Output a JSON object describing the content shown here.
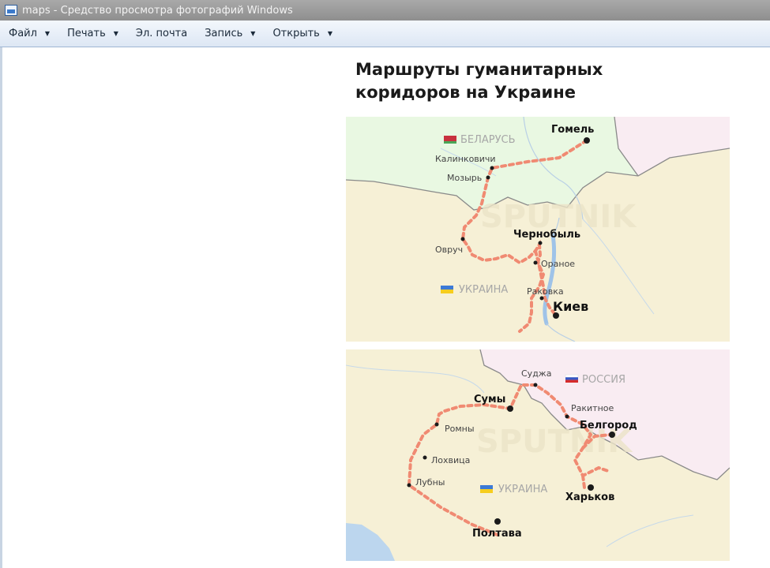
{
  "window": {
    "title": "maps - Средство просмотра фотографий Windows"
  },
  "menu": [
    {
      "label": "Файл",
      "has_dropdown": true
    },
    {
      "label": "Печать",
      "has_dropdown": true
    },
    {
      "label": "Эл. почта",
      "has_dropdown": false
    },
    {
      "label": "Запись",
      "has_dropdown": true
    },
    {
      "label": "Открыть",
      "has_dropdown": true
    }
  ],
  "image": {
    "heading_line1": "Маршруты гуманитарных",
    "heading_line2": "коридоров на Украине",
    "watermark": "SPUTNIK",
    "map1": {
      "countries": {
        "belarus": "БЕЛАРУСЬ",
        "ukraine": "УКРАИНА"
      },
      "cities": {
        "gomel": "Гомель",
        "kalinkovichi": "Калинковичи",
        "mozyr": "Мозырь",
        "chernobyl": "Чернобыль",
        "ovruch": "Овруч",
        "oranoe": "Ораное",
        "rakovka": "Раковка",
        "kiev": "Киев"
      }
    },
    "map2": {
      "countries": {
        "russia": "РОССИЯ",
        "ukraine": "УКРАИНА"
      },
      "cities": {
        "sudzha": "Суджа",
        "sumy": "Сумы",
        "rakitnoe": "Ракитное",
        "belgorod": "Белгород",
        "romny": "Ромны",
        "lokhvitsa": "Лохвица",
        "lubny": "Лубны",
        "kharkov": "Харьков",
        "poltava": "Полтава"
      }
    },
    "colors": {
      "route": "#f08a72",
      "ukraine_land": "#f6f0d6",
      "belarus_land": "#e9f8e2",
      "russia_land": "#f9ecf2",
      "water": "#bcd6ee",
      "border": "#8a8a8a"
    }
  }
}
